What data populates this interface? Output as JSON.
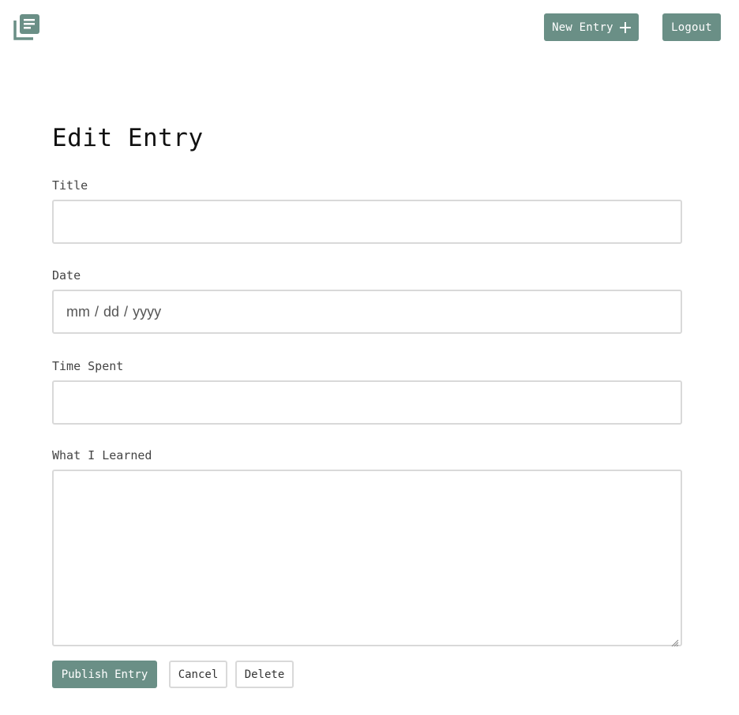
{
  "header": {
    "logo_icon": "journal-icon",
    "new_entry_label": "New Entry",
    "new_entry_icon": "plus-icon",
    "logout_label": "Logout"
  },
  "form": {
    "title": "Edit Entry",
    "fields": {
      "title": {
        "label": "Title",
        "value": "",
        "placeholder": ""
      },
      "date": {
        "label": "Date",
        "mm": "mm",
        "dd": "dd",
        "yyyy": "yyyy",
        "sep": "/"
      },
      "time_spent": {
        "label": "Time Spent",
        "value": "",
        "placeholder": ""
      },
      "learned": {
        "label": "What I Learned",
        "value": ""
      }
    },
    "actions": {
      "publish": "Publish Entry",
      "cancel": "Cancel",
      "delete": "Delete"
    }
  },
  "colors": {
    "accent": "#6a8f86",
    "input_border": "#d9d9d9",
    "text": "#2a2a2a"
  }
}
